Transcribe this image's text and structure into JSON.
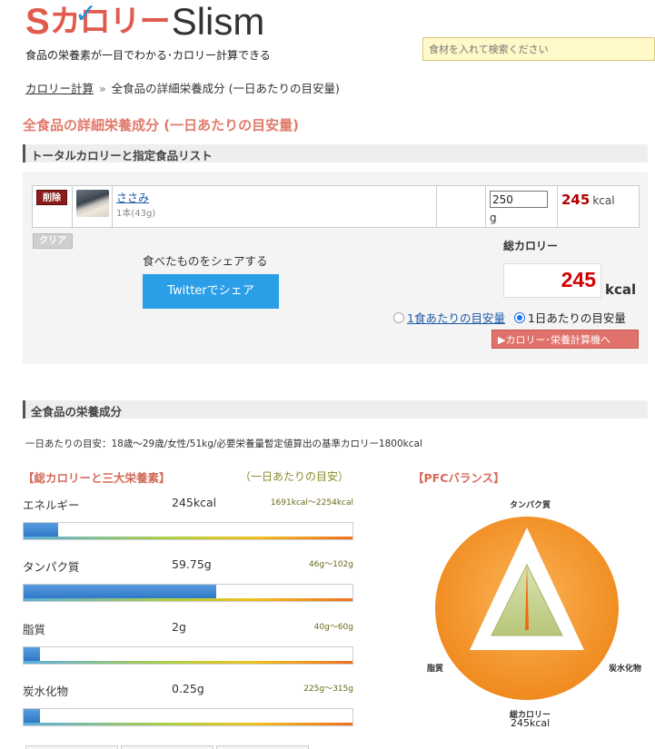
{
  "header": {
    "logo_kana": "カロリー",
    "logo_latin": "Slism",
    "tagline": "食品の栄養素が一目でわかる･カロリー計算できる",
    "search_placeholder": "食材を入れて検索ください"
  },
  "breadcrumb": {
    "home": "カロリー計算",
    "separator": "»",
    "current": "全食品の詳細栄養成分 (一日あたりの目安量)"
  },
  "page_title": "全食品の詳細栄養成分 (一日あたりの目安量)",
  "food_list": {
    "section_title": "トータルカロリーと指定食品リスト",
    "delete_label": "削除",
    "items": [
      {
        "name": "ささみ",
        "unit": "1本(43g)",
        "grams": "250",
        "gram_unit": "g",
        "kcal": "245",
        "kcal_unit": "kcal"
      }
    ],
    "clear_label": "クリア",
    "share_label": "食べたものをシェアする",
    "twitter_label": "Twitterでシェア",
    "total_label": "総カロリー",
    "total_value": "245",
    "total_unit": "kcal",
    "radio_per_meal": "1食あたりの目安量",
    "radio_per_day": "1日あたりの目安量",
    "selected": "per_day",
    "calc_button": "▶カロリー･栄養計算機へ"
  },
  "nutrition": {
    "section_title": "全食品の栄養成分",
    "basis": "一日あたりの目安：18歳～29歳/女性/51kg/必要栄養量暫定値算出の基準カロリー1800kcal",
    "heading_main": "【総カロリーと三大栄養素】",
    "heading_range": "（一日あたりの目安）",
    "heading_pfc": "【PFCバランス】",
    "items": [
      {
        "name": "エネルギー",
        "value": "245kcal",
        "range": "1691kcal～2254kcal",
        "fill": 0.105
      },
      {
        "name": "タンパク質",
        "value": "59.75g",
        "range": "46g～102g",
        "fill": 0.585
      },
      {
        "name": "脂質",
        "value": "2g",
        "range": "40g～60g",
        "fill": 0.05
      },
      {
        "name": "炭水化物",
        "value": "0.25g",
        "range": "225g～315g",
        "fill": 0.05
      }
    ],
    "pfc": {
      "protein_label": "タンパク質",
      "fat_label": "脂質",
      "carb_label": "炭水化物",
      "total_label": "総カロリー",
      "total_value": "245kcal"
    }
  },
  "colors": {
    "brand_red": "#e05a4e",
    "brand_blue": "#2a8fd8",
    "total_red": "#d40000",
    "twitter": "#2b9ee8",
    "pfc_orange": "#f39a3a"
  }
}
